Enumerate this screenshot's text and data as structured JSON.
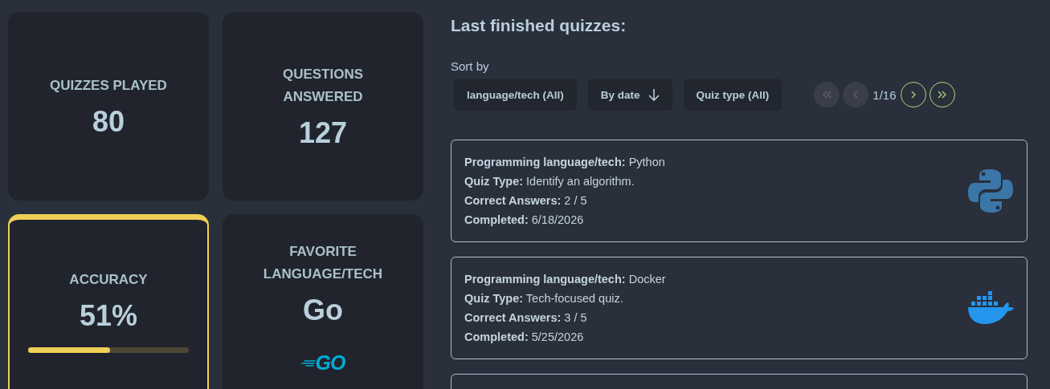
{
  "stats": [
    {
      "kind": "count",
      "label": "QUIZZES PLAYED",
      "value": "80",
      "highlighted": false
    },
    {
      "kind": "count",
      "label": "QUESTIONS ANSWERED",
      "value": "127",
      "highlighted": false
    },
    {
      "kind": "accuracy",
      "label": "ACCURACY",
      "value": "51%",
      "level": 0.51,
      "highlighted": true
    },
    {
      "kind": "favorite",
      "label": "FAVORITE LANGUAGE/TECH",
      "value": "Go",
      "logo": "GO",
      "highlighted": false
    }
  ],
  "heading": "Last finished quizzes:",
  "sort": {
    "label": "Sort by",
    "buttons": [
      {
        "label": "language/tech (All)",
        "kind": "plain"
      },
      {
        "label": "By date",
        "kind": "arrow"
      },
      {
        "label": "Quiz type (All)",
        "kind": "plain"
      }
    ]
  },
  "pagination": {
    "page": "1/16",
    "buttons": [
      {
        "kind": "first",
        "disabled": true
      },
      {
        "kind": "prev",
        "disabled": true
      },
      {
        "kind": "next",
        "disabled": false
      },
      {
        "kind": "last",
        "disabled": false
      }
    ]
  },
  "quizzes": [
    {
      "kind": "python",
      "lines": [
        "**Programming language/tech:** Python",
        "**Quiz Type:** Identify an algorithm.",
        "**Correct Answers:** 2 / 5",
        "**Completed:** 6/18/2026"
      ]
    },
    {
      "kind": "docker",
      "lines": [
        "**Programming language/tech:** Docker",
        "**Quiz Type:** Tech-focused quiz.",
        "**Correct Answers:** 3 / 5",
        "**Completed:** 5/25/2026"
      ]
    }
  ],
  "more_below": true
}
